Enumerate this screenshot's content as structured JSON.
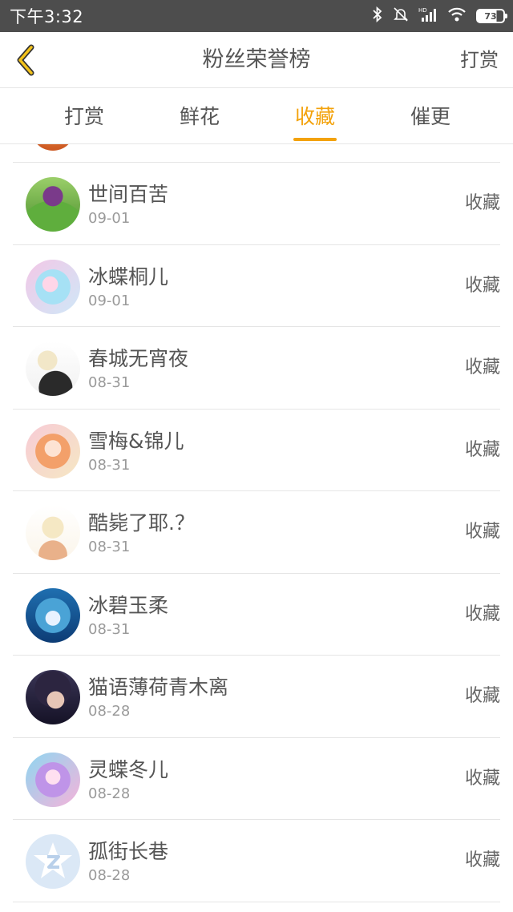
{
  "status_bar": {
    "time": "下午3:32",
    "battery": "73",
    "icons": [
      "bluetooth-icon",
      "mute-icon",
      "signal-icon",
      "wifi-icon",
      "battery-icon"
    ]
  },
  "header": {
    "title": "粉丝荣誉榜",
    "right_action": "打赏"
  },
  "tabs": [
    {
      "label": "打赏"
    },
    {
      "label": "鲜花"
    },
    {
      "label": "收藏"
    },
    {
      "label": "催更"
    }
  ],
  "active_tab": 2,
  "accent_color": "#f3a20b",
  "fans": [
    {
      "name": "世间百苦",
      "date": "09-01",
      "action": "收藏"
    },
    {
      "name": "冰蝶桐儿",
      "date": "09-01",
      "action": "收藏"
    },
    {
      "name": "春城无宵夜",
      "date": "08-31",
      "action": "收藏"
    },
    {
      "name": "雪梅&锦儿",
      "date": "08-31",
      "action": "收藏"
    },
    {
      "name": "酷毙了耶.？",
      "date": "08-31",
      "action": "收藏"
    },
    {
      "name": "冰碧玉柔",
      "date": "08-31",
      "action": "收藏"
    },
    {
      "name": "猫语薄荷青木离",
      "date": "08-28",
      "action": "收藏"
    },
    {
      "name": "灵蝶冬儿",
      "date": "08-28",
      "action": "收藏"
    },
    {
      "name": "孤街长巷",
      "date": "08-28",
      "action": "收藏"
    }
  ]
}
